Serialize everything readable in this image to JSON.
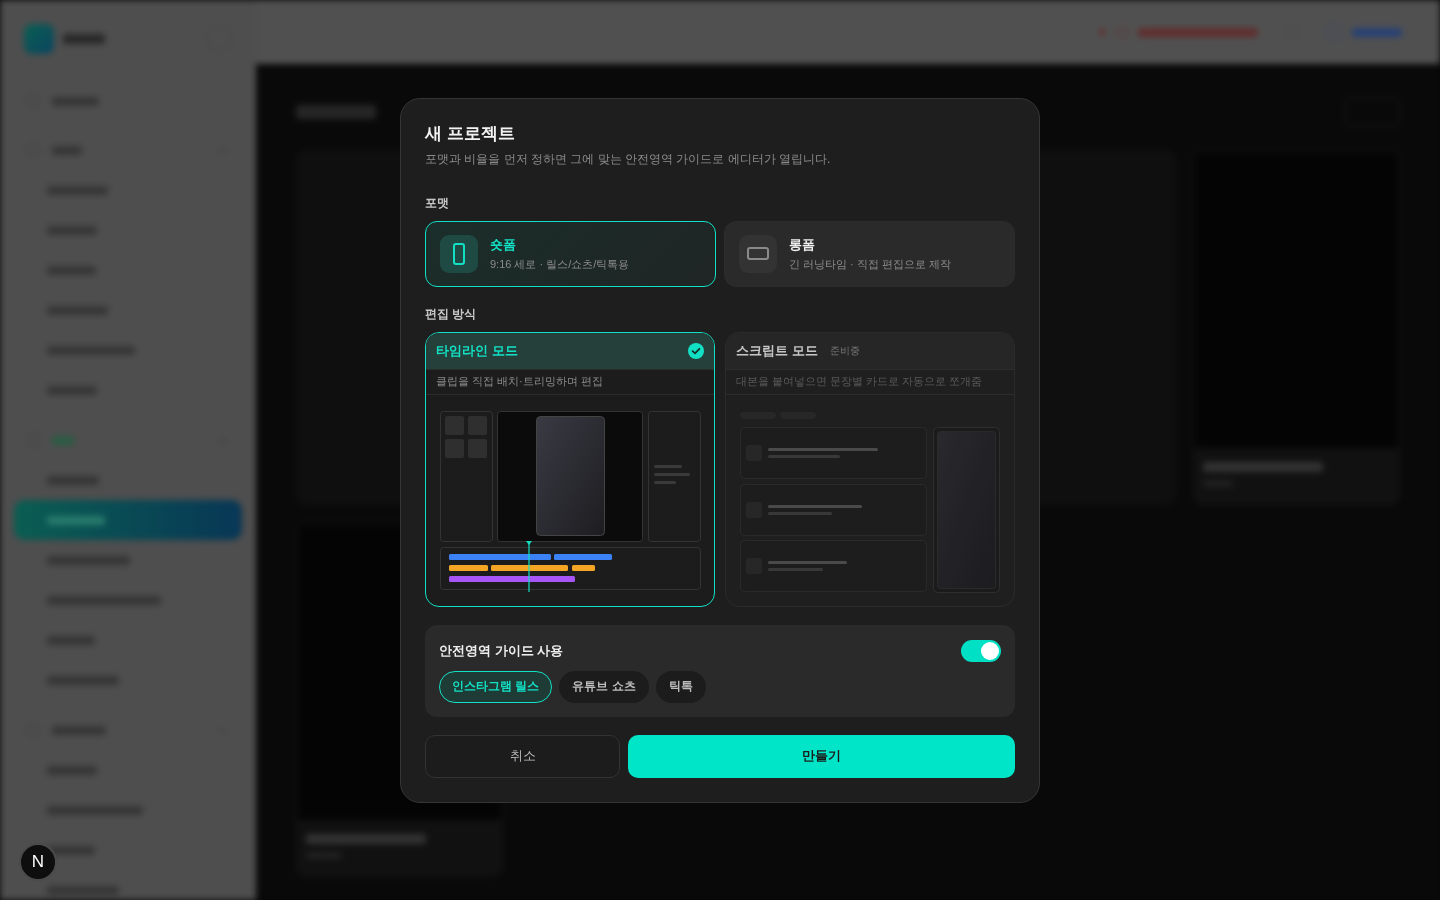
{
  "dialog": {
    "title": "새 프로젝트",
    "description": "포맷과 비율을 먼저 정하면 그에 맞는 안전영역 가이드로 에디터가 열립니다."
  },
  "format": {
    "label": "포맷",
    "options": [
      {
        "kind": "portrait",
        "title": "숏폼",
        "subtitle": "9:16 세로 · 릴스/쇼츠/틱톡용",
        "selected": true
      },
      {
        "kind": "landscape",
        "title": "롱폼",
        "subtitle": "긴 러닝타임 · 직접 편집으로 제작",
        "selected": false
      }
    ]
  },
  "edit_mode": {
    "label": "편집 방식",
    "options": [
      {
        "kind": "timeline",
        "title": "타임라인 모드",
        "description": "클립을 직접 배치·트리밍하며 편집",
        "selected": true,
        "disabled": false
      },
      {
        "kind": "script",
        "title": "스크립트 모드",
        "badge": "준비중",
        "description": "대본을 붙여넣으면 문장별 카드로 자동으로 쪼개줌",
        "selected": false,
        "disabled": true
      }
    ]
  },
  "safe_area": {
    "title": "안전영역 가이드 사용",
    "on": true,
    "platforms": [
      {
        "label": "인스타그램 릴스",
        "selected": true
      },
      {
        "label": "유튜브 쇼츠",
        "selected": false
      },
      {
        "label": "틱톡",
        "selected": false
      }
    ]
  },
  "buttons": [
    {
      "kind": "secondary",
      "label": "취소"
    },
    {
      "kind": "primary",
      "label": "만들기"
    }
  ],
  "dev_badge": {
    "label": "N"
  }
}
